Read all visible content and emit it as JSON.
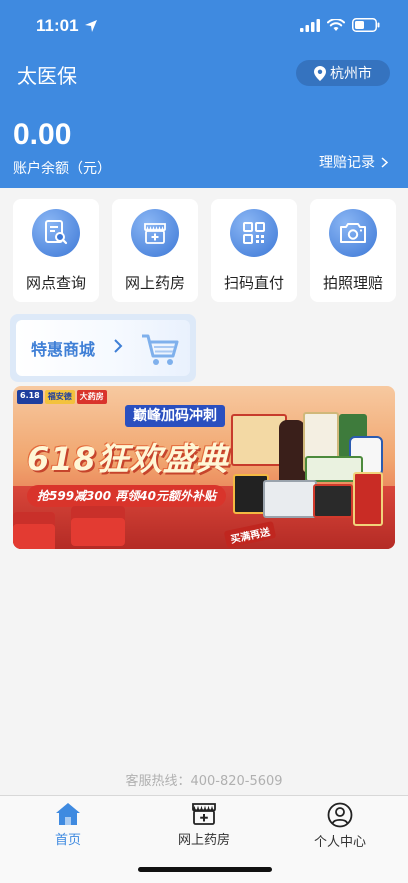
{
  "status_bar": {
    "time": "11:01"
  },
  "header": {
    "app_title": "太医保",
    "city": "杭州市",
    "balance": "0.00",
    "balance_label": "账户余额（元）",
    "claims_link": "理赔记录"
  },
  "quick_actions": [
    {
      "label": "网点查询",
      "icon": "search-document-icon"
    },
    {
      "label": "网上药房",
      "icon": "pharmacy-icon"
    },
    {
      "label": "扫码直付",
      "icon": "qr-code-icon"
    },
    {
      "label": "拍照理赔",
      "icon": "camera-icon"
    }
  ],
  "mall": {
    "label": "特惠商城"
  },
  "banner": {
    "tag_date": "6.18",
    "tag_brand1": "福安德",
    "tag_brand2": "大药房",
    "subtitle": "巅峰加码冲刺",
    "headline": "618狂欢盛典",
    "promo": "抢599减300 再领40元额外补贴",
    "footnote": "买满再送"
  },
  "footer": {
    "hotline": "客服热线：400-820-5609"
  },
  "tabbar": {
    "items": [
      {
        "label": "首页",
        "active": true
      },
      {
        "label": "网上药房",
        "active": false
      },
      {
        "label": "个人中心",
        "active": false
      }
    ]
  },
  "colors": {
    "primary": "#3f8ae0",
    "banner_red": "#d9342b"
  }
}
